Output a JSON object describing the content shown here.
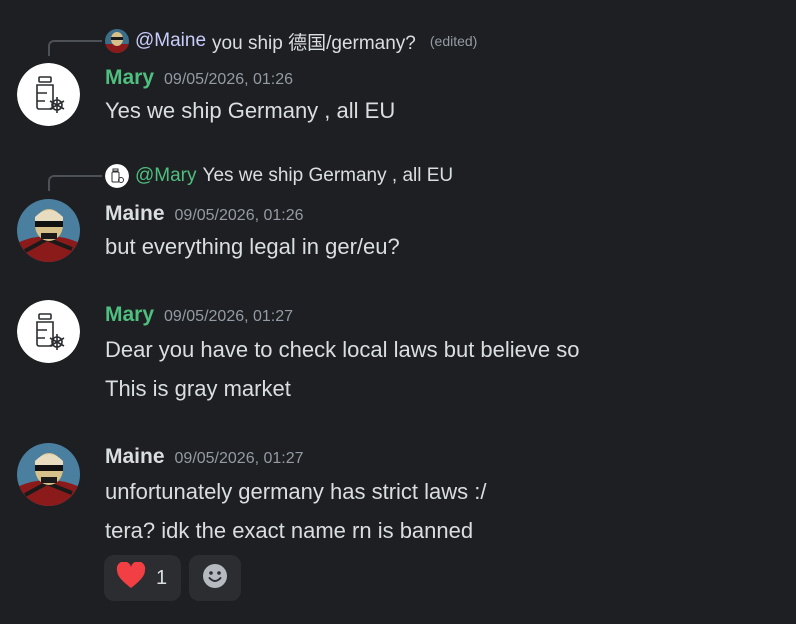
{
  "colors": {
    "background": "#1e1f22",
    "mary_name": "#4fbf7f",
    "maine_name": "#dbdee1",
    "text": "#dbdee1",
    "muted": "#949ba4",
    "reaction_bg": "#2b2d31",
    "heart": "#f23f43"
  },
  "messages": [
    {
      "reply": {
        "mention": "@Maine",
        "text": "you ship 德国/germany?",
        "edited": "(edited)"
      },
      "author": "Mary",
      "timestamp": "09/05/2026, 01:26",
      "lines": [
        "Yes we ship Germany , all EU"
      ]
    },
    {
      "reply": {
        "mention": "@Mary",
        "text": "Yes we ship Germany , all EU"
      },
      "author": "Maine",
      "timestamp": "09/05/2026, 01:26",
      "lines": [
        "but everything legal in ger/eu?"
      ]
    },
    {
      "author": "Mary",
      "timestamp": "09/05/2026, 01:27",
      "lines": [
        "Dear you have to check local laws but believe so",
        "This is gray market"
      ]
    },
    {
      "author": "Maine",
      "timestamp": "09/05/2026, 01:27",
      "lines": [
        "unfortunately germany has strict laws :/",
        "tera? idk the exact name rn is banned"
      ],
      "reactions": [
        {
          "icon": "heart-icon",
          "count": "1"
        }
      ]
    }
  ]
}
